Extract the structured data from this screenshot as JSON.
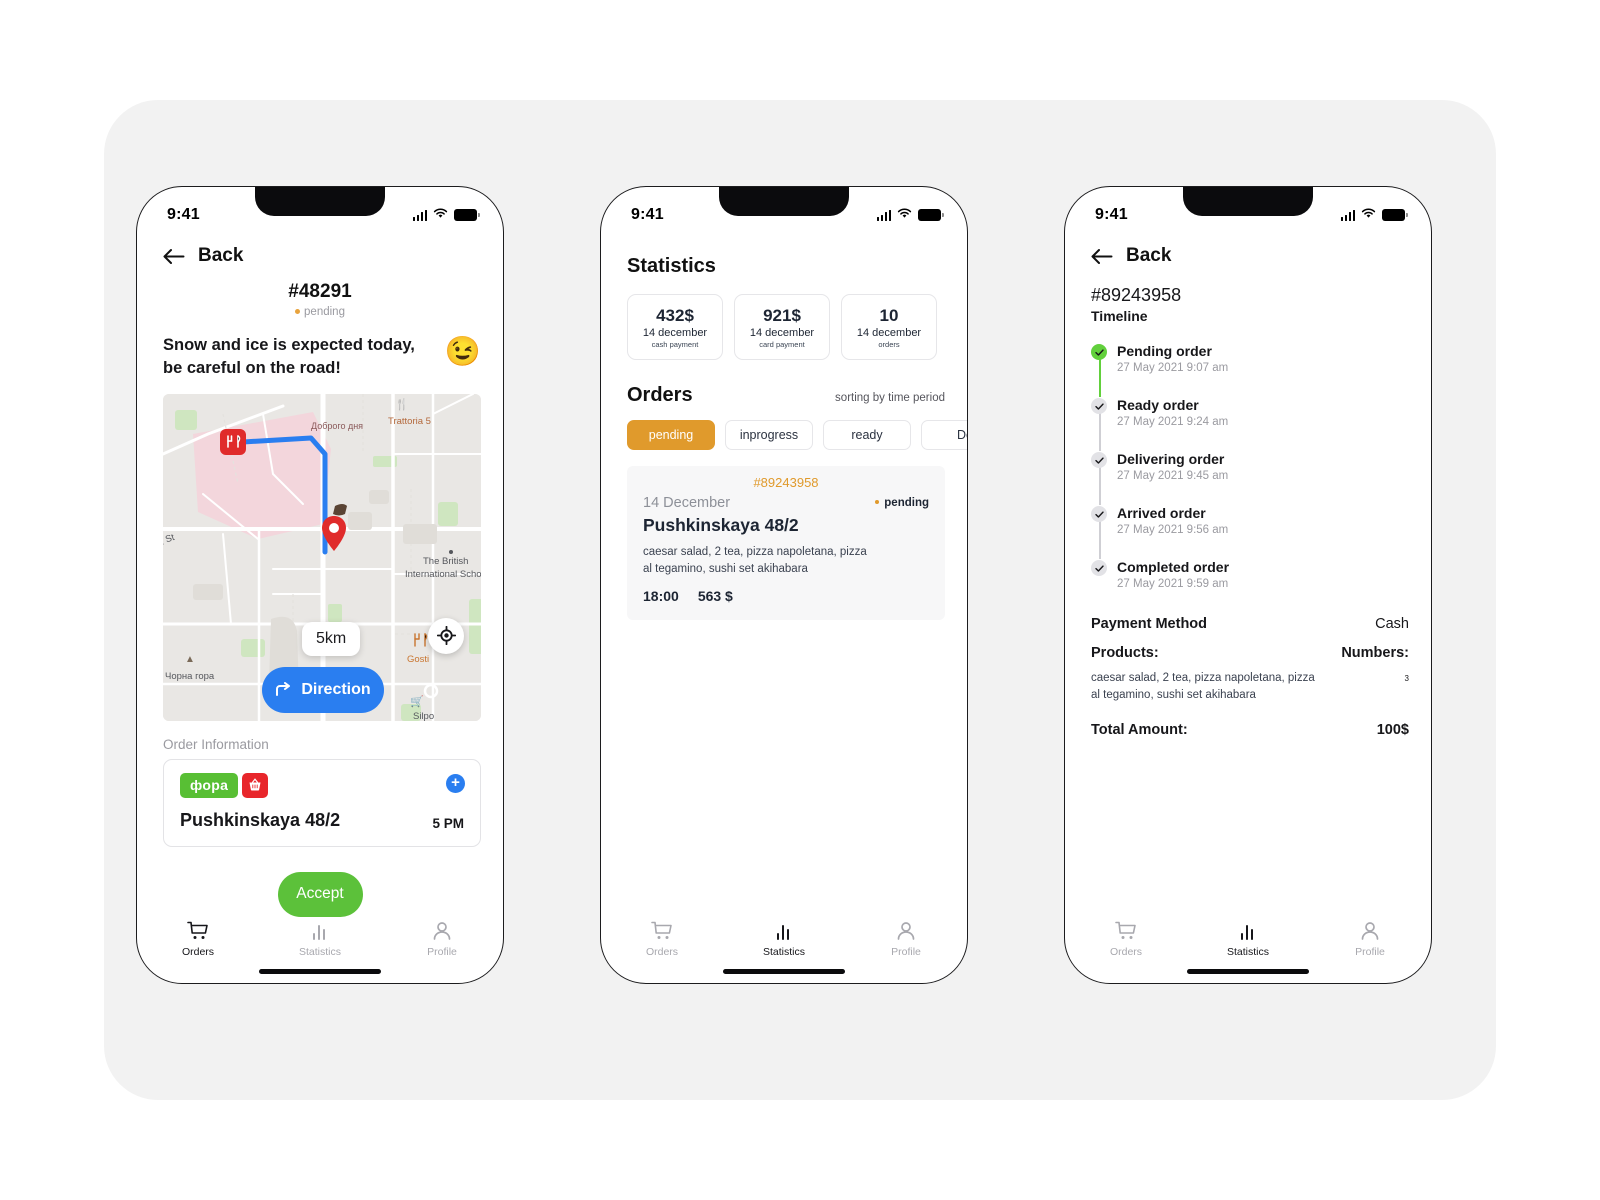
{
  "statusbar": {
    "time": "9:41"
  },
  "screen1": {
    "back_label": "Back",
    "order_id": "#48291",
    "status": "pending",
    "alert_text": "Snow and ice is expected today, be careful on the road!",
    "alert_emoji": "😉",
    "map": {
      "distance_badge": "5km",
      "direction_label": "Direction",
      "labels": {
        "dobrogo": "Доброго дня",
        "trattoria": "Trattoria 5",
        "british": "The British International Schoo",
        "gosti": "Gosti",
        "silpo": "Silpo",
        "chorna": "Чорна гора",
        "street": "St"
      }
    },
    "section_label": "Order Information",
    "store_logo": "фора",
    "address": "Pushkinskaya 48/2",
    "address_time": "5 PM",
    "accept_label": "Accept",
    "tabs": [
      {
        "label": "Orders",
        "icon": "cart-icon",
        "active": true
      },
      {
        "label": "Statistics",
        "icon": "bars-icon",
        "active": false
      },
      {
        "label": "Profile",
        "icon": "person-icon",
        "active": false
      }
    ]
  },
  "screen2": {
    "title": "Statistics",
    "stats": [
      {
        "value": "432$",
        "date": "14 december",
        "sub": "cash payment"
      },
      {
        "value": "921$",
        "date": "14 december",
        "sub": "card payment"
      },
      {
        "value": "10",
        "date": "14 december",
        "sub": "orders"
      }
    ],
    "orders_title": "Orders",
    "sorting_label": "sorting by time period",
    "chips": [
      {
        "label": "pending",
        "active": true
      },
      {
        "label": "inprogress",
        "active": false
      },
      {
        "label": "ready",
        "active": false
      },
      {
        "label": "De",
        "active": false
      }
    ],
    "order": {
      "id": "#89243958",
      "date": "14 December",
      "status": "pending",
      "address": "Pushkinskaya 48/2",
      "items": "caesar salad, 2 tea, pizza napoletana, pizza al tegamino, sushi set akihabara",
      "time": "18:00",
      "price": "563 $"
    },
    "tabs": [
      {
        "label": "Orders",
        "icon": "cart-icon",
        "active": false
      },
      {
        "label": "Statistics",
        "icon": "bars-icon",
        "active": true
      },
      {
        "label": "Profile",
        "icon": "person-icon",
        "active": false
      }
    ]
  },
  "screen3": {
    "back_label": "Back",
    "order_id": "#89243958",
    "timeline_label": "Timeline",
    "timeline": [
      {
        "title": "Pending order",
        "time": "27 May 2021 9:07 am"
      },
      {
        "title": "Ready order",
        "time": "27 May 2021 9:24 am"
      },
      {
        "title": "Delivering order",
        "time": "27 May 2021 9:45 am"
      },
      {
        "title": "Arrived order",
        "time": "27 May 2021 9:56 am"
      },
      {
        "title": "Completed order",
        "time": "27 May 2021 9:59 am"
      }
    ],
    "payment_method_key": "Payment Method",
    "payment_method_val": "Cash",
    "products_key": "Products:",
    "numbers_key": "Numbers:",
    "numbers_val": "3",
    "products_val": "caesar salad, 2 tea, pizza napoletana, pizza al tegamino, sushi set akihabara",
    "total_key": "Total Amount:",
    "total_val": "100$",
    "tabs": [
      {
        "label": "Orders",
        "icon": "cart-icon",
        "active": false
      },
      {
        "label": "Statistics",
        "icon": "bars-icon",
        "active": true
      },
      {
        "label": "Profile",
        "icon": "person-icon",
        "active": false
      }
    ]
  },
  "colors": {
    "accent_orange": "#e09a2c",
    "accent_blue": "#2a7ef0",
    "accent_green": "#5cc13a",
    "timeline_green": "#62d03c",
    "canvas": "#f2f2f2"
  }
}
